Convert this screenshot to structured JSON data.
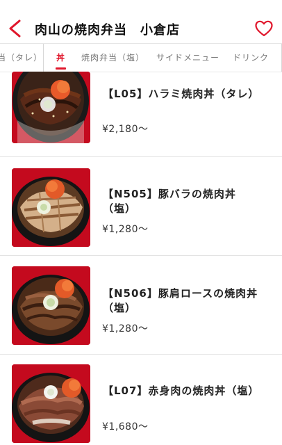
{
  "header": {
    "title": "肉山の焼肉弁当　小倉店",
    "back_icon": "chevron-left-icon",
    "favorite_icon": "heart-outline-icon",
    "accent_color": "#e0162b"
  },
  "tabs": [
    {
      "label": "当（タレ）"
    },
    {
      "label": "丼",
      "active": true
    },
    {
      "label": "焼肉弁当（塩）"
    },
    {
      "label": "サイドメニュー"
    },
    {
      "label": "ドリンク"
    }
  ],
  "items": [
    {
      "name": "【L05】ハラミ焼肉丼（タレ）",
      "price": "¥2,180〜"
    },
    {
      "name": "【N505】豚バラの焼肉丼（塩）",
      "price": "¥1,280〜"
    },
    {
      "name": "【N506】豚肩ロースの焼肉丼（塩）",
      "price": "¥1,280〜"
    },
    {
      "name": "【L07】赤身肉の焼肉丼（塩）",
      "price": "¥1,680〜"
    }
  ]
}
